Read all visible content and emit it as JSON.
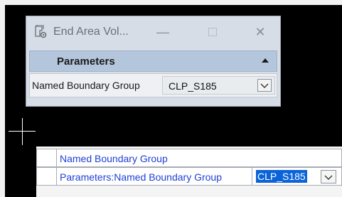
{
  "window": {
    "title": "End Area Vol...",
    "controls": {
      "minimize": "—",
      "close": "✕"
    }
  },
  "section": {
    "title": "Parameters"
  },
  "parameter": {
    "label": "Named Boundary Group",
    "value": "CLP_S185"
  },
  "prompt": {
    "row1_text": "Named Boundary Group",
    "row2_text": "Parameters:Named Boundary Group",
    "row2_value": "CLP_S185"
  },
  "icons": {
    "app": "document-gear-icon",
    "collapse": "chevron-up-icon",
    "dropdown": "chevron-down-icon"
  }
}
